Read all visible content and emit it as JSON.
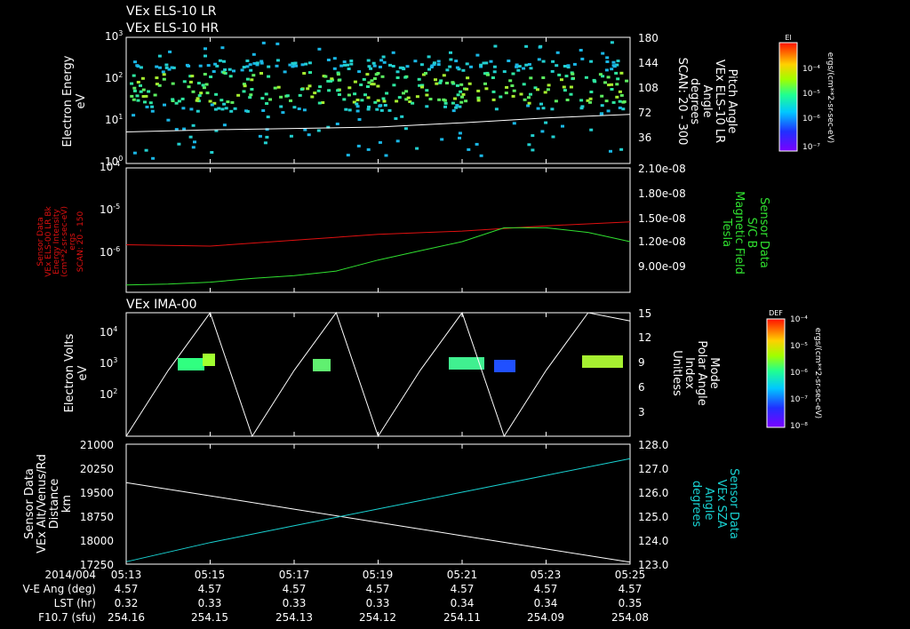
{
  "panels": {
    "p1": {
      "titles": [
        "VEx ELS-10 LR",
        "VEx ELS-10 HR"
      ],
      "ylabel_left": [
        "Electron Energy",
        "eV"
      ],
      "ylabel_right": [
        "Pitch Angle",
        "VEx ELS-10 LR",
        "Angle",
        "degrees",
        "SCAN: 20 - 300"
      ],
      "left_ticks": [
        {
          "base": "10",
          "exp": "3"
        },
        {
          "base": "10",
          "exp": "2"
        },
        {
          "base": "10",
          "exp": "1"
        },
        {
          "base": "10",
          "exp": "0"
        }
      ],
      "right_ticks": [
        "180",
        "144",
        "108",
        "72",
        "36"
      ],
      "colorbar": {
        "title": "El",
        "ticks": [
          "10⁻⁴",
          "10⁻⁵",
          "10⁻⁶",
          "10⁻⁷"
        ],
        "unit": "ergs/(cm**2-sr-sec-eV)"
      }
    },
    "p2": {
      "ylabel_left": [
        "Sensor Data",
        "VEx ELS-00 LR Bk",
        "Energy Intensity",
        "(cm**2-sr-sec-eV)",
        "ergs",
        "SCAN: 20 - 150"
      ],
      "ylabel_right": [
        "Sensor Data",
        "S/C B",
        "Magnetic Field",
        "Tesla"
      ],
      "left_ticks": [
        {
          "base": "10",
          "exp": "-4"
        },
        {
          "base": "10",
          "exp": "-5"
        },
        {
          "base": "10",
          "exp": "-6"
        }
      ],
      "right_ticks": [
        "2.10e-08",
        "1.80e-08",
        "1.50e-08",
        "1.20e-08",
        "9.00e-09"
      ]
    },
    "p3": {
      "title": "VEx IMA-00",
      "ylabel_left": [
        "Electron Volts",
        "eV"
      ],
      "ylabel_right": [
        "Mode",
        "Polar Angle",
        "Index",
        "Unitless"
      ],
      "left_ticks": [
        {
          "base": "10",
          "exp": "4"
        },
        {
          "base": "10",
          "exp": "3"
        },
        {
          "base": "10",
          "exp": "2"
        }
      ],
      "right_ticks": [
        "15",
        "12",
        "9",
        "6",
        "3"
      ],
      "colorbar": {
        "title": "DEF",
        "ticks": [
          "10⁻⁴",
          "10⁻⁵",
          "10⁻⁶",
          "10⁻⁷",
          "10⁻⁸"
        ],
        "unit": "ergs/(cm**2-sr-sec-eV)"
      }
    },
    "p4": {
      "ylabel_left": [
        "Sensor Data",
        "VEx Alt/Venus/Rd",
        "Distance",
        "km"
      ],
      "ylabel_right": [
        "Sensor Data",
        "VEx SZA",
        "Angle",
        "degrees"
      ],
      "left_ticks": [
        "21000",
        "20250",
        "19500",
        "18750",
        "18000",
        "17250"
      ],
      "right_ticks": [
        "128.0",
        "127.0",
        "126.0",
        "125.0",
        "124.0",
        "123.0"
      ]
    }
  },
  "footer": {
    "row_labels": [
      "2014/004",
      "V-E Ang (deg)",
      "LST (hr)",
      "F10.7 (sfu)"
    ],
    "times": [
      "05:13",
      "05:15",
      "05:17",
      "05:19",
      "05:21",
      "05:23",
      "05:25"
    ],
    "ve_ang": [
      "4.57",
      "4.57",
      "4.57",
      "4.57",
      "4.57",
      "4.57",
      "4.57"
    ],
    "lst": [
      "0.32",
      "0.33",
      "0.33",
      "0.33",
      "0.34",
      "0.34",
      "0.35"
    ],
    "f107": [
      "254.16",
      "254.15",
      "254.13",
      "254.12",
      "254.11",
      "254.09",
      "254.08"
    ]
  },
  "colors": {
    "red_trace": "#e01010",
    "green_trace": "#30e030",
    "cyan_trace": "#19d3d3",
    "white_trace": "#ffffff",
    "left_label_p2": "#e01010",
    "right_label_p2": "#30e030",
    "right_label_p4": "#19d3d3"
  },
  "chart_data": [
    {
      "type": "heatmap",
      "title": "VEx ELS-10 LR / VEx ELS-10 HR",
      "x": [
        "05:13",
        "05:15",
        "05:17",
        "05:19",
        "05:21",
        "05:23",
        "05:25"
      ],
      "ylabel": "Electron Energy (eV)",
      "ylim": [
        1,
        1000
      ],
      "yscale": "log",
      "y2label": "Pitch Angle VEx ELS-10 LR Angle degrees SCAN: 20 - 300",
      "y2lim": [
        0,
        180
      ],
      "series": [
        {
          "name": "Pitch Angle VEx ELS-10 LR",
          "x": [
            "05:13",
            "05:15",
            "05:17",
            "05:19",
            "05:21",
            "05:23",
            "05:25"
          ],
          "y": [
            45,
            48,
            50,
            52,
            58,
            65,
            70
          ]
        }
      ]
    },
    {
      "type": "line",
      "x": [
        "05:13",
        "05:15",
        "05:17",
        "05:19",
        "05:21",
        "05:23",
        "05:25"
      ],
      "ylabel": "Sensor Data VEx ELS-00 LR Bk Energy Intensity (cm**2-sr-sec-eV) ergs SCAN: 20 - 150",
      "ylim": [
        1e-07,
        0.0001
      ],
      "yscale": "log",
      "y2label": "Sensor Data S/C B Magnetic Field Tesla",
      "y2lim": [
        7.5e-09,
        2.1e-08
      ],
      "series": [
        {
          "name": "Sensor Data VEx ELS-00 LR Bk",
          "axis": "left",
          "x": [
            "05:13",
            "05:15",
            "05:17",
            "05:19",
            "05:21",
            "05:23",
            "05:25"
          ],
          "y": [
            1.4e-06,
            1.3e-06,
            1.8e-06,
            2.5e-06,
            3e-06,
            4e-06,
            5e-06
          ]
        },
        {
          "name": "Sensor Data S/C B",
          "axis": "right",
          "x": [
            "05:13",
            "05:14",
            "05:15",
            "05:16",
            "05:17",
            "05:18",
            "05:19",
            "05:20",
            "05:21",
            "05:22",
            "05:23",
            "05:24",
            "05:25"
          ],
          "y": [
            8.3e-09,
            8.4e-09,
            8.6e-09,
            9e-09,
            9.3e-09,
            9.8e-09,
            1.1e-08,
            1.2e-08,
            1.3e-08,
            1.45e-08,
            1.45e-08,
            1.4e-08,
            1.3e-08
          ]
        }
      ]
    },
    {
      "type": "heatmap",
      "title": "VEx IMA-00",
      "x": [
        "05:13",
        "05:15",
        "05:17",
        "05:19",
        "05:21",
        "05:23",
        "05:25"
      ],
      "ylabel": "Electron Volts (eV)",
      "ylim": [
        10,
        100000
      ],
      "yscale": "log",
      "y2label": "Mode Polar Angle Index Unitless",
      "y2lim": [
        0,
        15
      ],
      "series": [
        {
          "name": "Mode Polar Angle Index",
          "x": [
            "05:13",
            "05:14",
            "05:15",
            "05:16",
            "05:17",
            "05:18",
            "05:19",
            "05:20",
            "05:21",
            "05:22",
            "05:23",
            "05:24",
            "05:25"
          ],
          "y": [
            0,
            8,
            16,
            0,
            8,
            16,
            0,
            8,
            16,
            0,
            8,
            16,
            14
          ]
        }
      ]
    },
    {
      "type": "line",
      "x": [
        "05:13",
        "05:15",
        "05:17",
        "05:19",
        "05:21",
        "05:23",
        "05:25"
      ],
      "ylabel": "Sensor Data VEx Alt/Venus/Rd Distance km",
      "ylim": [
        17250,
        21000
      ],
      "y2label": "Sensor Data VEx SZA Angle degrees",
      "y2lim": [
        123.0,
        128.0
      ],
      "series": [
        {
          "name": "VEx Alt/Venus/Rd",
          "axis": "left",
          "x": [
            "05:13",
            "05:15",
            "05:17",
            "05:19",
            "05:21",
            "05:23",
            "05:25"
          ],
          "y": [
            19800,
            19385,
            18970,
            18555,
            18140,
            17725,
            17310
          ]
        },
        {
          "name": "VEx SZA",
          "axis": "right",
          "x": [
            "05:13",
            "05:15",
            "05:17",
            "05:19",
            "05:21",
            "05:23",
            "05:25"
          ],
          "y": [
            123.1,
            123.9,
            124.6,
            125.3,
            126.0,
            126.7,
            127.4
          ]
        }
      ]
    }
  ]
}
